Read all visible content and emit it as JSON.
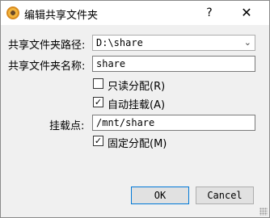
{
  "window": {
    "title": "编辑共享文件夹",
    "help_glyph": "?",
    "close_glyph": "✕"
  },
  "form": {
    "path_label": "共享文件夹路径:",
    "path_value": "D:\\share",
    "name_label": "共享文件夹名称:",
    "name_value": "share",
    "readonly": {
      "label": "只读分配(R)",
      "checked": false
    },
    "automount": {
      "label": "自动挂载(A)",
      "checked": true
    },
    "mountpoint_label": "挂载点:",
    "mountpoint_value": "/mnt/share",
    "permanent": {
      "label": "固定分配(M)",
      "checked": true
    }
  },
  "buttons": {
    "ok": "OK",
    "cancel": "Cancel"
  },
  "icons": {
    "app": "virtualbox-icon",
    "dropdown": "chevron-down-icon",
    "check": "checkmark-icon"
  }
}
